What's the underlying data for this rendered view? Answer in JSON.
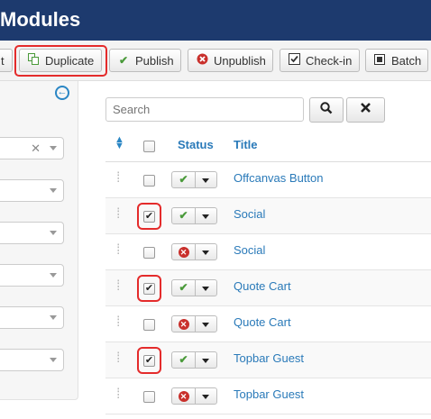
{
  "header": {
    "title": "Modules"
  },
  "toolbar": {
    "partial_label": "t",
    "duplicate_label": "Duplicate",
    "publish_label": "Publish",
    "unpublish_label": "Unpublish",
    "checkin_label": "Check-in",
    "batch_label": "Batch"
  },
  "search": {
    "placeholder": "Search"
  },
  "table": {
    "headers": {
      "status": "Status",
      "title": "Title"
    },
    "rows": [
      {
        "title": "Offcanvas Button",
        "checked": false,
        "published": true
      },
      {
        "title": "Social",
        "checked": true,
        "published": true
      },
      {
        "title": "Social",
        "checked": false,
        "published": false
      },
      {
        "title": "Quote Cart",
        "checked": true,
        "published": true
      },
      {
        "title": "Quote Cart",
        "checked": false,
        "published": false
      },
      {
        "title": "Topbar Guest",
        "checked": true,
        "published": true
      },
      {
        "title": "Topbar Guest",
        "checked": false,
        "published": false
      }
    ]
  },
  "colors": {
    "header": "#1d3a6e",
    "link": "#2a7ab9",
    "highlight": "#e42b2b",
    "published": "#4a9a3a",
    "unpublished": "#c9302c"
  }
}
